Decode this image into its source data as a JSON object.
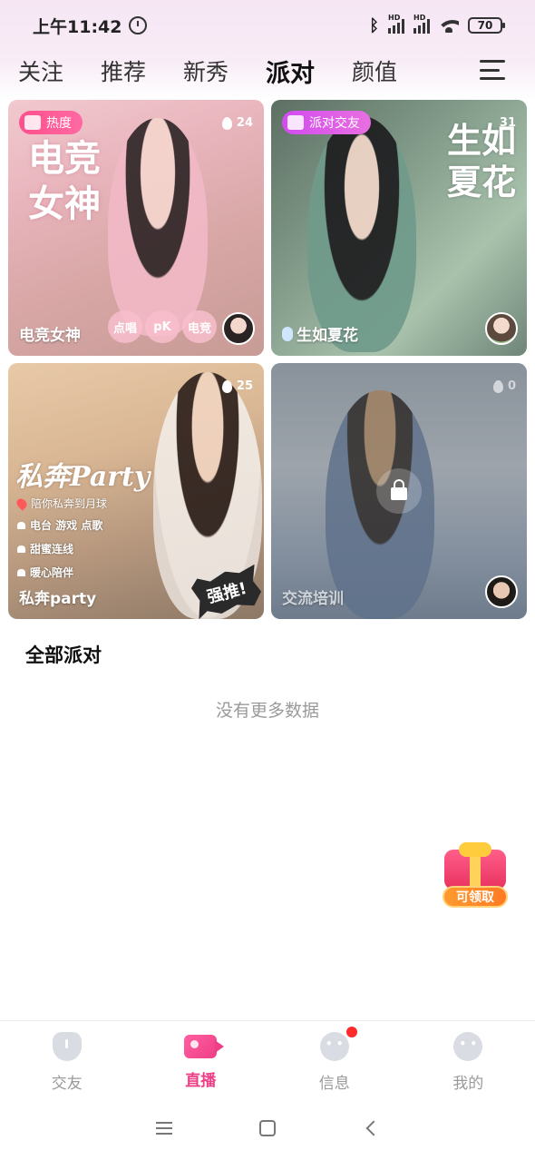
{
  "status_bar": {
    "time": "上午11:42",
    "signal_label_1": "HD",
    "signal_label_2": "HD",
    "battery": "70"
  },
  "tabs": [
    {
      "label": "关注"
    },
    {
      "label": "推荐"
    },
    {
      "label": "新秀"
    },
    {
      "label": "派对",
      "active": true
    },
    {
      "label": "颜值"
    }
  ],
  "cards": [
    {
      "badge": "热度",
      "heat": "24",
      "overlay_title": "电竞女神",
      "title": "电竞女神",
      "tags": [
        "点唱",
        "pK",
        "电竞"
      ]
    },
    {
      "badge": "派对交友",
      "heat": "31",
      "overlay_title": "生如夏花",
      "title": "生如夏花"
    },
    {
      "heat": "25",
      "overlay_title": "私奔Party",
      "subline": "陪你私奔到月球",
      "features": [
        "电台 游戏 点歌",
        "甜蜜连线",
        "暖心陪伴"
      ],
      "stamp": "强推!",
      "title": "私奔party"
    },
    {
      "heat": "0",
      "title": "交流培训",
      "locked": true
    }
  ],
  "section": {
    "title": "全部派对",
    "empty_text": "没有更多数据"
  },
  "gift": {
    "label": "可领取"
  },
  "bottom_nav": [
    {
      "label": "交友",
      "icon": "shield-icon"
    },
    {
      "label": "直播",
      "icon": "camera-icon",
      "active": true
    },
    {
      "label": "信息",
      "icon": "chat-icon",
      "has_dot": true
    },
    {
      "label": "我的",
      "icon": "face-icon"
    }
  ],
  "colors": {
    "accent": "#ee3f86",
    "badge_heat": "#ff4f8b",
    "badge_party": "#d24bf0",
    "gift_label": "#ff8a28"
  }
}
